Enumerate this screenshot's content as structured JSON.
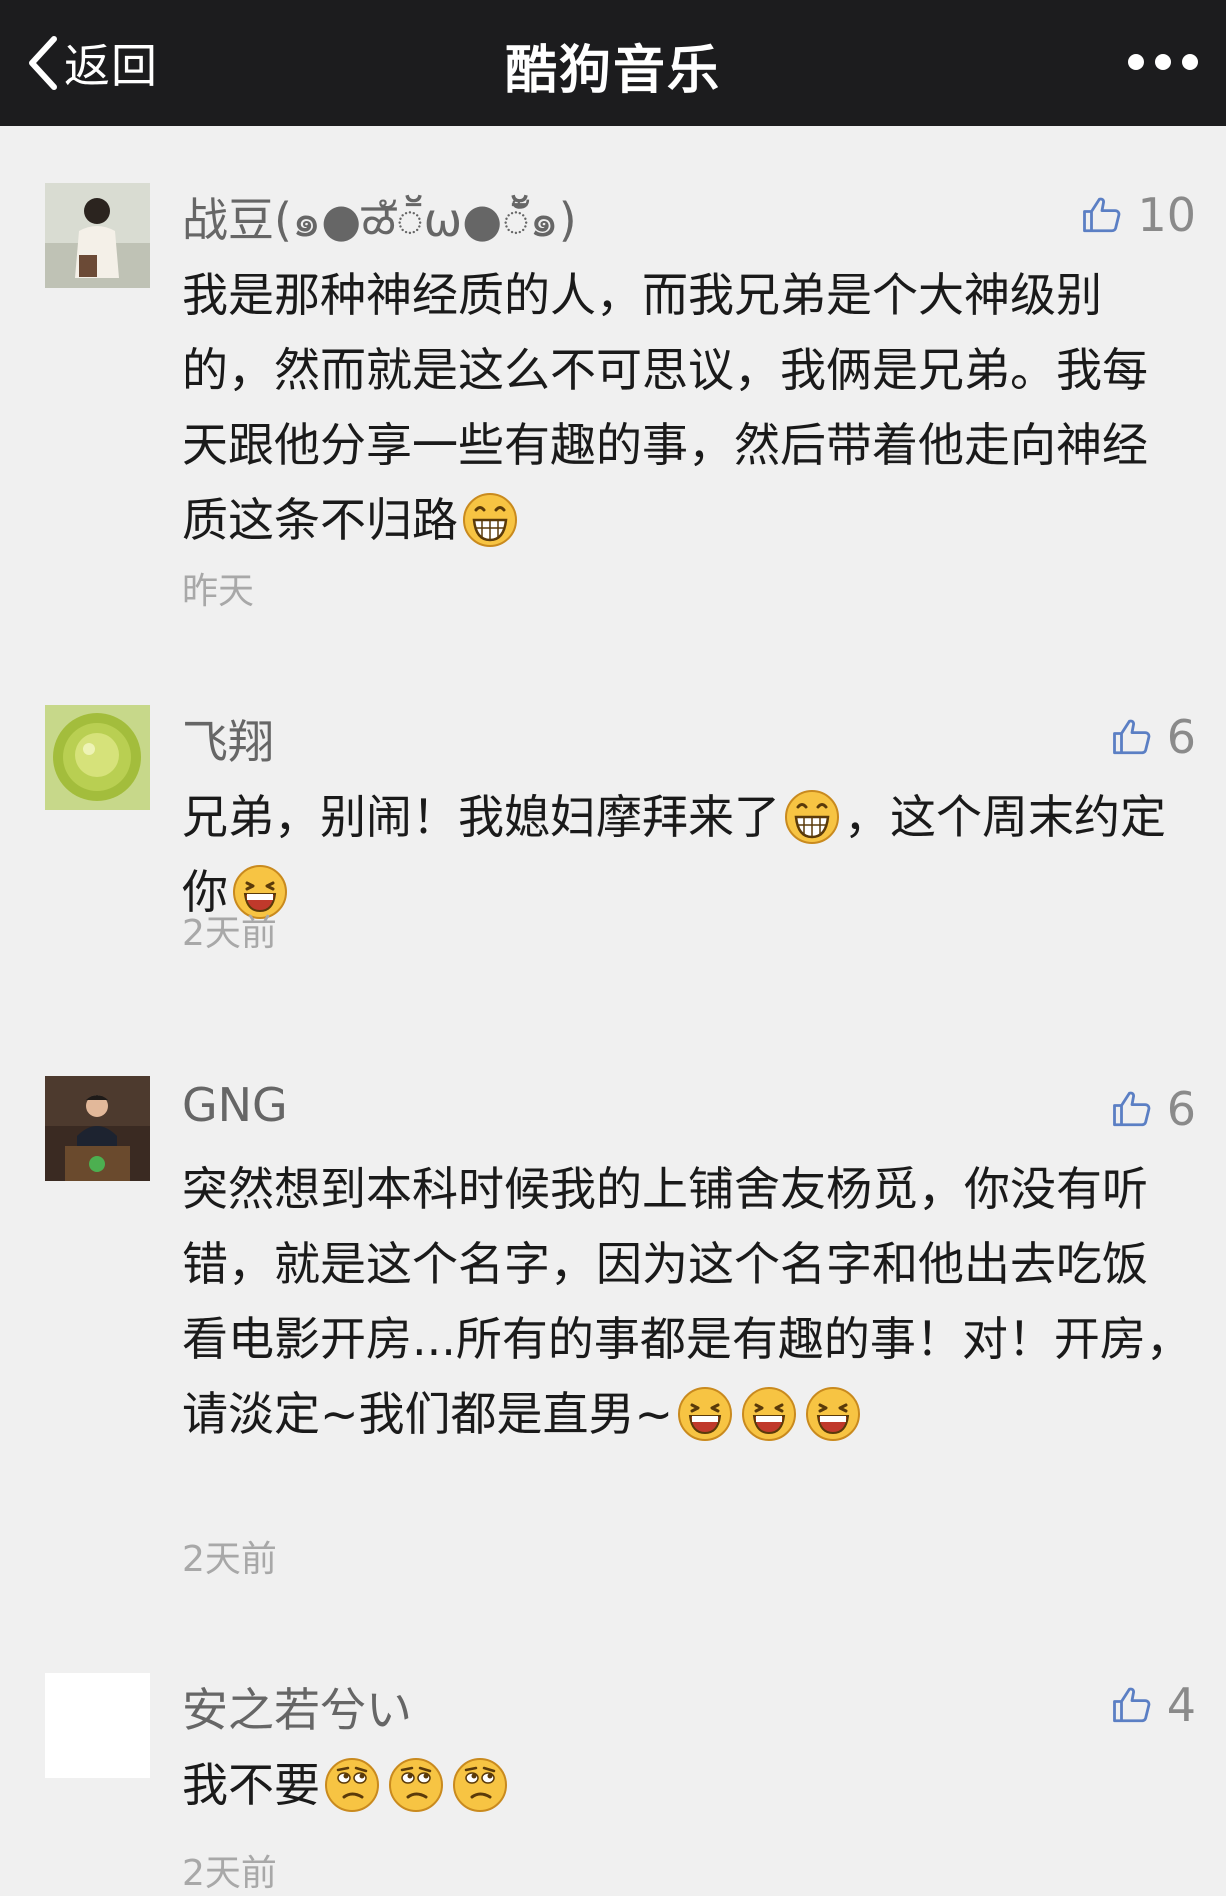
{
  "nav": {
    "back_label": "返回",
    "title": "酷狗音乐"
  },
  "comments": [
    {
      "name": "战豆(๑●ळัॕω●ॕั๑)",
      "likes": "10",
      "text_parts": [
        "我是那种神经质的人，而我兄弟是个大神级别的，然而就是这么不可思议，我俩是兄弟。我每天跟他分享一些有趣的事，然后带着他走向神经质这条不归路"
      ],
      "emojis": [
        "grin-emoji"
      ],
      "time": "昨天"
    },
    {
      "name": "飞翔",
      "likes": "6",
      "text_parts": [
        "兄弟，别闹！我媳妇摩拜来了",
        "，这个周末约定你"
      ],
      "emojis": [
        "grin-emoji",
        "smile-emoji"
      ],
      "time": "2天前"
    },
    {
      "name": "GNG",
      "likes": "6",
      "text_parts": [
        "突然想到本科时候我的上铺舍友杨觅，你没有听错，就是这个名字，因为这个名字和他出去吃饭看电影开房...所有的事都是有趣的事！对！开房，请淡定~我们都是直男~"
      ],
      "emojis": [
        "smile-emoji",
        "smile-emoji",
        "smile-emoji"
      ],
      "time": "2天前"
    },
    {
      "name": "安之若兮い",
      "likes": "4",
      "text_parts": [
        "我不要"
      ],
      "emojis": [
        "confused-emoji",
        "confused-emoji",
        "confused-emoji"
      ],
      "time": "2天前"
    }
  ],
  "colors": {
    "topbar": "#1c1c1e",
    "background": "#f0f0f0",
    "like_icon": "#5b7fc4",
    "emoji_yellow": "#f7c443"
  }
}
